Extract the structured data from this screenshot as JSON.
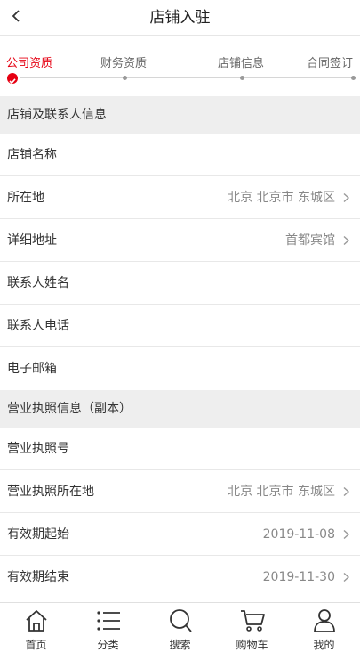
{
  "header": {
    "title": "店铺入驻"
  },
  "steps": [
    {
      "label": "公司资质",
      "active": true
    },
    {
      "label": "财务资质",
      "active": false
    },
    {
      "label": "店铺信息",
      "active": false
    },
    {
      "label": "合同签订",
      "active": false
    }
  ],
  "section1": {
    "title": "店铺及联系人信息",
    "rows": [
      {
        "label": "店铺名称",
        "value": ""
      },
      {
        "label": "所在地",
        "value": "北京 北京市 东城区"
      },
      {
        "label": "详细地址",
        "value": "首都宾馆"
      },
      {
        "label": "联系人姓名",
        "value": ""
      },
      {
        "label": "联系人电话",
        "value": ""
      },
      {
        "label": "电子邮箱",
        "value": ""
      }
    ]
  },
  "section2": {
    "title": "营业执照信息（副本）",
    "rows": [
      {
        "label": "营业执照号",
        "value": ""
      },
      {
        "label": "营业执照所在地",
        "value": "北京 北京市 东城区"
      },
      {
        "label": "有效期起始",
        "value": "2019-11-08"
      },
      {
        "label": "有效期结束",
        "value": "2019-11-30"
      }
    ]
  },
  "tabbar": [
    {
      "label": "首页",
      "icon": "home-icon"
    },
    {
      "label": "分类",
      "icon": "list-icon"
    },
    {
      "label": "搜索",
      "icon": "search-icon"
    },
    {
      "label": "购物车",
      "icon": "cart-icon"
    },
    {
      "label": "我的",
      "icon": "user-icon"
    }
  ],
  "colors": {
    "accent": "#e60012",
    "section_bg": "#eeeeee",
    "divider": "#e8e8e8"
  }
}
